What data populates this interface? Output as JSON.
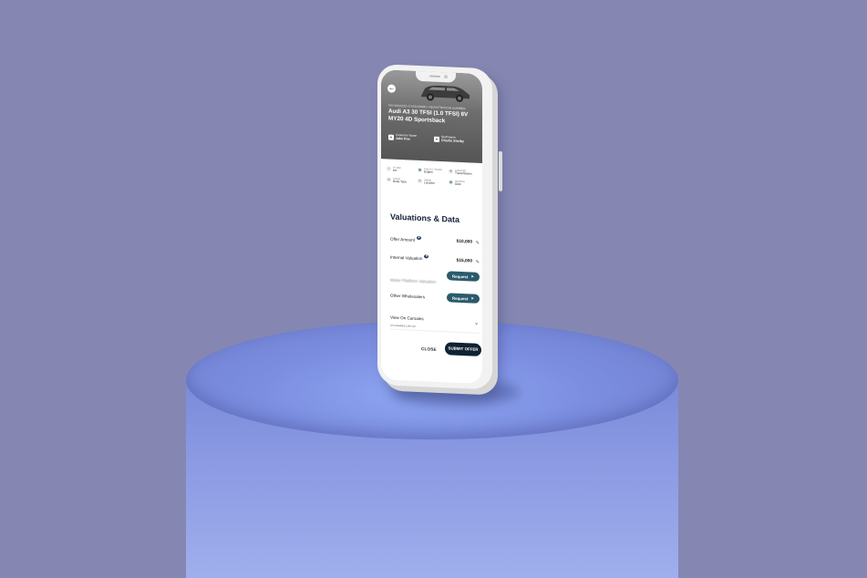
{
  "hero": {
    "back_icon": "arrow-left-icon",
    "subtitle": "VIN WAUZZZ-GYA2140000 | REGISTRATION NUMBER",
    "title": "Audi A3 30 TFSI (1.0 TFSI) 8V MY20 4D Sportsback",
    "customer_label": "Customer Name",
    "customer_value": "Jake Doe",
    "staff_label": "Staff Name",
    "staff_value": "Charlie Shelby"
  },
  "specs": [
    {
      "icon": "odometer-icon",
      "label": "15,000",
      "value": "km"
    },
    {
      "icon": "engine-icon",
      "label": "Fuel 2.0 / Petrol",
      "value": "Engine"
    },
    {
      "icon": "gear-icon",
      "label": "Automatic",
      "value": "Transmission"
    },
    {
      "icon": "car-icon",
      "label": "Colour",
      "value": "Body Type"
    },
    {
      "icon": "car-icon",
      "label": "Sedan",
      "value": "Location"
    },
    {
      "icon": "calendar-icon",
      "label": "03/02/22",
      "value": "Date"
    }
  ],
  "valuations": {
    "title": "Valuations & Data",
    "offer_label": "Offer Amount",
    "offer_value": "$10,000",
    "internal_label": "Internal Valuation",
    "internal_value": "$15,000",
    "motor_label": "Motor Platform Valuation",
    "wholesalers_label": "Other Wholesalers",
    "request_label": "Request",
    "carsales_label": "View On Carsales",
    "carsales_sub": "on carsales.com.au"
  },
  "footer": {
    "close_label": "CLOSE",
    "submit_label": "SUBMIT OFFER"
  }
}
